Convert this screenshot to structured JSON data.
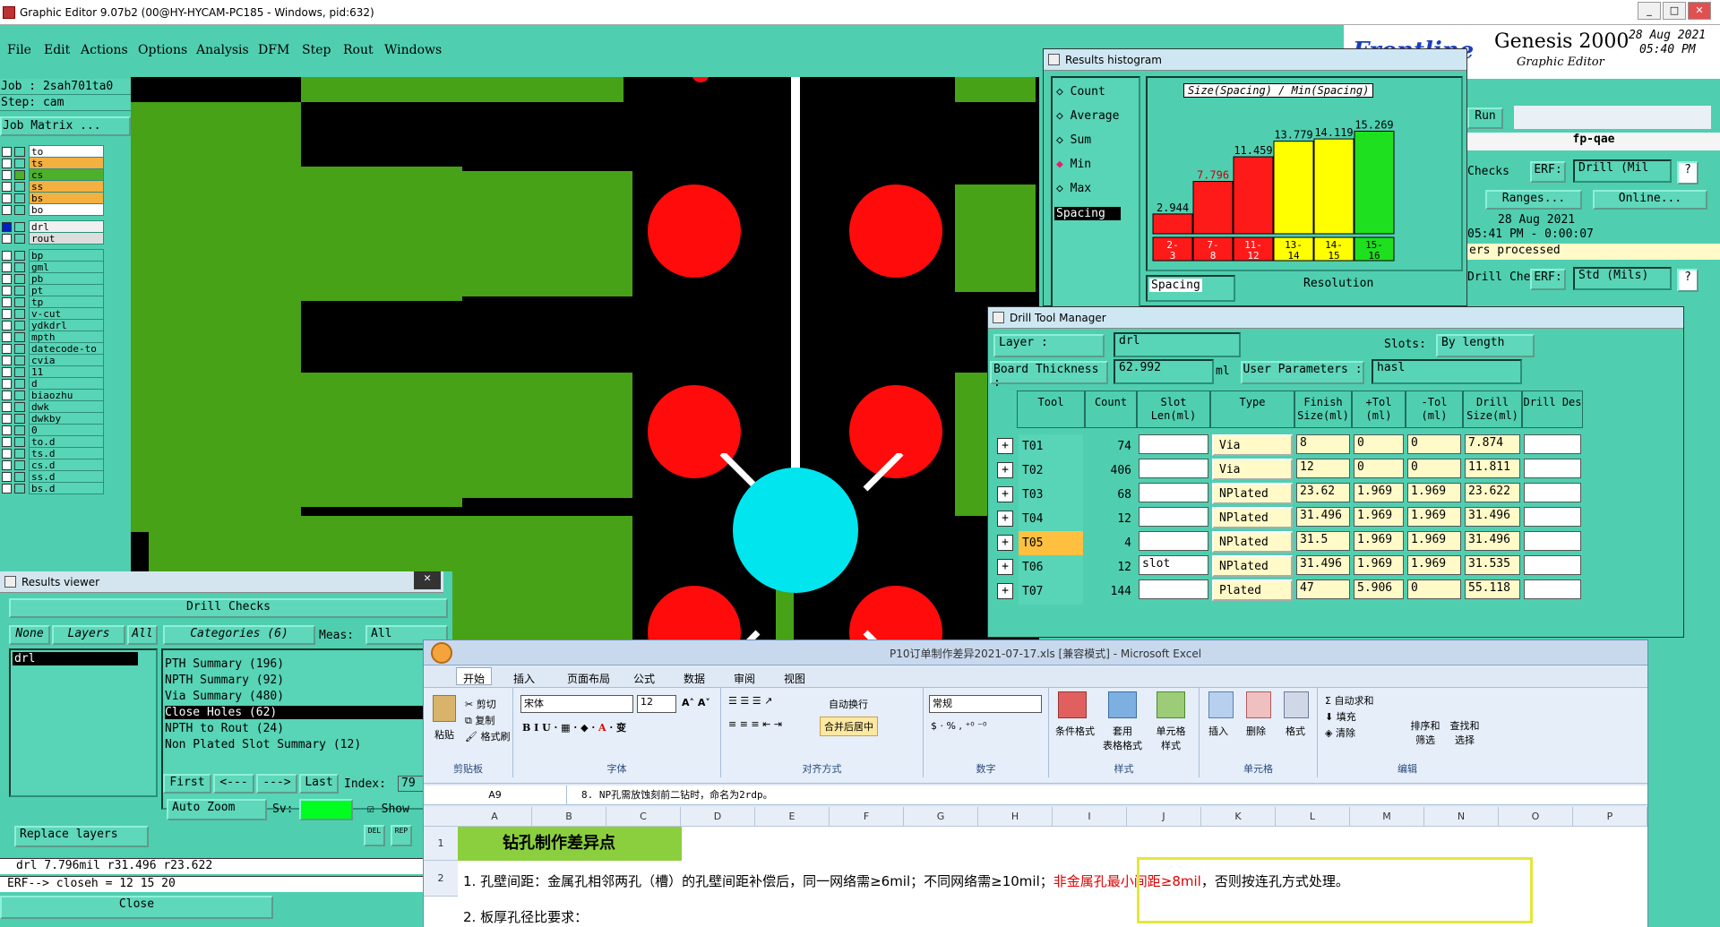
{
  "window": {
    "title": "Graphic Editor 9.07b2 (00@HY-HYCAM-PC185 - Windows, pid:632)",
    "min": "_",
    "max": "□",
    "close": "✕"
  },
  "menu": [
    "File",
    "Edit",
    "Actions",
    "Options",
    "Analysis",
    "DFM",
    "Step",
    "Rout",
    "Windows"
  ],
  "job": {
    "job_line": "Job : 2sah701ta0",
    "step_line": "Step: cam",
    "matrix_btn": "Job Matrix ..."
  },
  "layers": [
    "to",
    "ts",
    "cs",
    "ss",
    "bs",
    "bo",
    "drl",
    "rout",
    "bp",
    "gml",
    "pb",
    "pt",
    "tp",
    "v-cut",
    "ydkdrl",
    "mpth",
    "datecode-to",
    "cvia",
    "11",
    "d",
    "biaozhu",
    "dwk",
    "dwkby",
    "0",
    "to.d",
    "ts.d",
    "cs.d",
    "ss.d",
    "bs.d"
  ],
  "colors": {
    "board": "#47a217",
    "pad": "#ff0b0b",
    "selected_pad": "#00e5ee",
    "ui_bg": "#4fcfb0",
    "field_bg": "#fffac8",
    "highlight_border": "#e6e63a"
  },
  "genesis": {
    "logo": "Frontline",
    "name": "Genesis 2000",
    "sub": "Graphic Editor",
    "date": "28 Aug 2021",
    "time": "05:40 PM"
  },
  "right_panel": {
    "run": "Run",
    "user": "fp-qae",
    "checks": "Checks",
    "erf": "ERF:",
    "drill_field": "Drill (Mil",
    "q": "?",
    "ranges": "Ranges...",
    "online": "Online...",
    "date": "28 Aug 2021",
    "time_line": "05:41 PM - 0:00:07",
    "processed": "ers processed",
    "drill_che": "Drill Che",
    "erf2": "ERF:",
    "std_field": "Std (Mils)"
  },
  "histogram": {
    "title": "Results histogram",
    "modes": [
      "Count",
      "Average",
      "Sum",
      "Min",
      "Max"
    ],
    "selected_mode": "Min",
    "spacing_label": "Spacing",
    "header": "Size(Spacing) / Min(Spacing)",
    "resolution": "Resolution",
    "spacing_field": "Spacing"
  },
  "chart_data": {
    "type": "bar",
    "title": "Size(Spacing) / Min(Spacing)",
    "categories": [
      "2-3",
      "7-8",
      "11-12",
      "13-14",
      "14-15",
      "15-16"
    ],
    "values": [
      2.944,
      7.796,
      11.459,
      13.779,
      14.119,
      15.269
    ],
    "bar_colors": [
      "#ff1a1a",
      "#ff1a1a",
      "#ff1a1a",
      "#ffff00",
      "#ffff00",
      "#1fe01f"
    ],
    "value_colors": [
      "#000",
      "#cc0000",
      "#000",
      "#000",
      "#000",
      "#000"
    ],
    "ylim": [
      0,
      16
    ]
  },
  "dtm": {
    "title": "Drill Tool Manager",
    "layer_label": "Layer              :",
    "layer_value": "drl",
    "slots_label": "Slots:",
    "slots_value": "By length",
    "thickness_label": "Board Thickness :",
    "thickness_value": "62.992",
    "unit": "ml",
    "user_params_label": "User Parameters :",
    "user_params_value": "hasl",
    "headers": [
      "Tool",
      "Count",
      "Slot Len(ml)",
      "Type",
      "Finish Size(ml)",
      "+Tol (ml)",
      "-Tol (ml)",
      "Drill Size(ml)",
      "Drill Des"
    ],
    "rows": [
      {
        "tool": "T01",
        "count": "74",
        "slot": "",
        "type": "Via",
        "finish": "8",
        "ptol": "0",
        "mtol": "0",
        "drill": "7.874"
      },
      {
        "tool": "T02",
        "count": "406",
        "slot": "",
        "type": "Via",
        "finish": "12",
        "ptol": "0",
        "mtol": "0",
        "drill": "11.811"
      },
      {
        "tool": "T03",
        "count": "68",
        "slot": "",
        "type": "NPlated",
        "finish": "23.62",
        "ptol": "1.969",
        "mtol": "1.969",
        "drill": "23.622"
      },
      {
        "tool": "T04",
        "count": "12",
        "slot": "",
        "type": "NPlated",
        "finish": "31.496",
        "ptol": "1.969",
        "mtol": "1.969",
        "drill": "31.496"
      },
      {
        "tool": "T05",
        "count": "4",
        "slot": "",
        "type": "NPlated",
        "finish": "31.5",
        "ptol": "1.969",
        "mtol": "1.969",
        "drill": "31.496"
      },
      {
        "tool": "T06",
        "count": "12",
        "slot": "slot",
        "type": "NPlated",
        "finish": "31.496",
        "ptol": "1.969",
        "mtol": "1.969",
        "drill": "31.535"
      },
      {
        "tool": "T07",
        "count": "144",
        "slot": "",
        "type": "Plated",
        "finish": "47",
        "ptol": "5.906",
        "mtol": "0",
        "drill": "55.118"
      }
    ]
  },
  "results_viewer": {
    "title": "Results viewer",
    "drill_checks": "Drill Checks",
    "none": "None",
    "layers": "Layers",
    "all": "All",
    "categories": "Categories (6)",
    "meas": "Meas:",
    "meas_val": "All",
    "layer_item": "drl",
    "items": [
      "PTH Summary (196)",
      "NPTH Summary (92)",
      "Via Summary (480)",
      "Close Holes (62)",
      "NPTH to Rout (24)",
      "Non Plated Slot Summary (12)"
    ],
    "selected_item": "Close Holes (62)",
    "nav": [
      "First",
      "<---",
      "--->",
      "Last"
    ],
    "index": "Index:",
    "index_val": "79",
    "auto_zoom": "Auto Zoom",
    "sv": "Sv:",
    "show": "Show",
    "replace_layers": "Replace layers",
    "status": "drl  7.796mil   r31.496   r23.622",
    "erf": "ERF--> closeh = 12 15 20",
    "close": "Close"
  },
  "excel": {
    "title": "P10订单制作差异2021-07-17.xls  [兼容模式] - Microsoft Excel",
    "tabs": [
      "开始",
      "插入",
      "页面布局",
      "公式",
      "数据",
      "审阅",
      "视图"
    ],
    "clipboard": {
      "paste": "粘贴",
      "cut": "剪切",
      "copy": "复制",
      "format": "格式刷",
      "label": "剪贴板"
    },
    "font": {
      "name": "宋体",
      "size": "12",
      "label": "字体"
    },
    "align": {
      "wrap": "自动换行",
      "merge": "合并后居中",
      "label": "对齐方式"
    },
    "number": {
      "format": "常规",
      "label": "数字"
    },
    "styles": {
      "cond": "条件格式",
      "table": "套用\n表格格式",
      "cell": "单元格\n样式",
      "label": "样式"
    },
    "cells": {
      "insert": "插入",
      "delete": "删除",
      "format": "格式",
      "label": "单元格"
    },
    "edit": {
      "autosum": "自动求和",
      "fill": "填充",
      "clear": "清除",
      "sort": "排序和\n筛选",
      "find": "查找和\n选择",
      "label": "编辑"
    },
    "name_box": "A9",
    "formula": "8. NP孔需放蚀刻前二钻时，命名为2rdp。",
    "columns": [
      "A",
      "B",
      "C",
      "D",
      "E",
      "F",
      "G",
      "H",
      "I",
      "J",
      "K",
      "L",
      "M",
      "N",
      "O",
      "P"
    ],
    "rows": [
      "1",
      "2"
    ],
    "a1": "钻孔制作差异点",
    "row2_black": "1. 孔壁间距：金属孔相邻两孔（槽）的孔壁间距补偿后，同一网络需≥6mil；不同网络需≥10mil；",
    "row2_red": "非金属孔最小间距≥8mil",
    "row2_tail": "，否则按连孔方式处理。",
    "row3": "2. 板厚孔径比要求："
  }
}
